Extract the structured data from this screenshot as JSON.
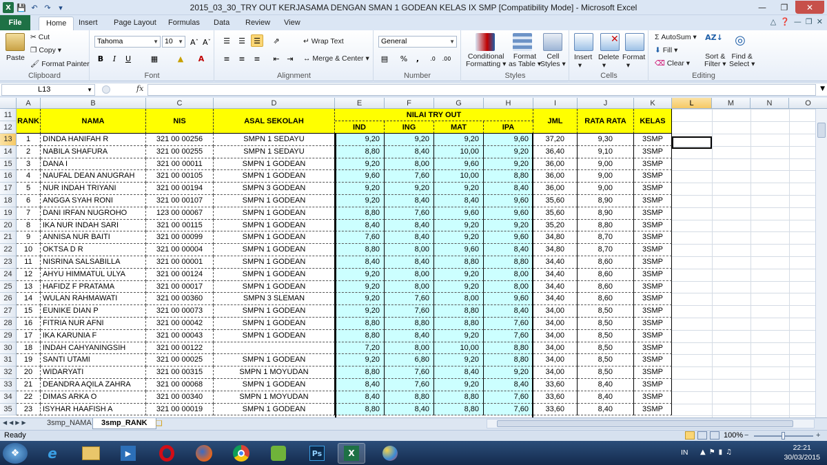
{
  "window": {
    "title": "2015_03_30_TRY OUT KERJASAMA DENGAN SMAN 1 GODEAN KELAS IX SMP  [Compatibility Mode]  -  Microsoft Excel"
  },
  "ribbon_tabs": [
    "File",
    "Home",
    "Insert",
    "Page Layout",
    "Formulas",
    "Data",
    "Review",
    "View"
  ],
  "ribbon": {
    "clipboard": {
      "paste": "Paste",
      "cut": "Cut",
      "copy": "Copy",
      "format_painter": "Format Painter",
      "group": "Clipboard"
    },
    "font": {
      "name": "Tahoma",
      "size": "10",
      "group": "Font"
    },
    "alignment": {
      "wrap_text": "Wrap Text",
      "merge_center": "Merge & Center",
      "group": "Alignment"
    },
    "number": {
      "format": "General",
      "group": "Number"
    },
    "styles": {
      "conditional": "Conditional",
      "conditional2": "Formatting",
      "format_table": "Format",
      "format_table2": "as Table",
      "cell_styles": "Cell",
      "cell_styles2": "Styles",
      "group": "Styles"
    },
    "cells": {
      "insert": "Insert",
      "delete": "Delete",
      "format": "Format",
      "group": "Cells"
    },
    "editing": {
      "autosum": "AutoSum",
      "fill": "Fill",
      "clear": "Clear",
      "sort": "Sort &",
      "sort2": "Filter",
      "find": "Find &",
      "find2": "Select",
      "group": "Editing"
    }
  },
  "formula_bar": {
    "name_box": "L13",
    "fx": "fx",
    "content": ""
  },
  "columns": [
    "A",
    "B",
    "C",
    "D",
    "E",
    "F",
    "G",
    "H",
    "I",
    "J",
    "K",
    "L",
    "M",
    "N",
    "O"
  ],
  "header": {
    "rank": "RANK",
    "nama": "NAMA",
    "nis": "NIS",
    "asal": "ASAL SEKOLAH",
    "nilai": "NILAI TRY OUT",
    "ind": "IND",
    "ing": "ING",
    "mat": "MAT",
    "ipa": "IPA",
    "jml": "JML",
    "rata": "RATA RATA",
    "kelas": "KELAS"
  },
  "row_numbers_header": [
    "11",
    "12"
  ],
  "rows": [
    {
      "r": "13",
      "rank": "1",
      "nama": "DINDA HANIFAH R",
      "nis": "321 00 00256",
      "asal": "SMPN 1 SEDAYU",
      "ind": "9,20",
      "ing": "9,20",
      "mat": "9,20",
      "ipa": "9,60",
      "jml": "37,20",
      "rata": "9,30",
      "kelas": "3SMP"
    },
    {
      "r": "14",
      "rank": "2",
      "nama": "NABILA SHAFURA",
      "nis": "321 00 00255",
      "asal": "SMPN 1 SEDAYU",
      "ind": "8,80",
      "ing": "8,40",
      "mat": "10,00",
      "ipa": "9,20",
      "jml": "36,40",
      "rata": "9,10",
      "kelas": "3SMP"
    },
    {
      "r": "15",
      "rank": "3",
      "nama": "DANA I",
      "nis": "321 00 00011",
      "asal": "SMPN 1 GODEAN",
      "ind": "9,20",
      "ing": "8,00",
      "mat": "9,60",
      "ipa": "9,20",
      "jml": "36,00",
      "rata": "9,00",
      "kelas": "3SMP"
    },
    {
      "r": "16",
      "rank": "4",
      "nama": "NAUFAL DEAN ANUGRAH",
      "nis": "321 00 00105",
      "asal": "SMPN 1 GODEAN",
      "ind": "9,60",
      "ing": "7,60",
      "mat": "10,00",
      "ipa": "8,80",
      "jml": "36,00",
      "rata": "9,00",
      "kelas": "3SMP"
    },
    {
      "r": "17",
      "rank": "5",
      "nama": "NUR INDAH TRIYANI",
      "nis": "321 00 00194",
      "asal": "SMPN 3 GODEAN",
      "ind": "9,20",
      "ing": "9,20",
      "mat": "9,20",
      "ipa": "8,40",
      "jml": "36,00",
      "rata": "9,00",
      "kelas": "3SMP"
    },
    {
      "r": "18",
      "rank": "6",
      "nama": "ANGGA SYAH RONI",
      "nis": "321 00 00107",
      "asal": "SMPN 1 GODEAN",
      "ind": "9,20",
      "ing": "8,40",
      "mat": "8,40",
      "ipa": "9,60",
      "jml": "35,60",
      "rata": "8,90",
      "kelas": "3SMP"
    },
    {
      "r": "19",
      "rank": "7",
      "nama": "DANI IRFAN NUGROHO",
      "nis": "123 00 00067",
      "asal": "SMPN 1 GODEAN",
      "ind": "8,80",
      "ing": "7,60",
      "mat": "9,60",
      "ipa": "9,60",
      "jml": "35,60",
      "rata": "8,90",
      "kelas": "3SMP"
    },
    {
      "r": "20",
      "rank": "8",
      "nama": "IKA NUR INDAH SARI",
      "nis": "321 00 00115",
      "asal": "SMPN 1 GODEAN",
      "ind": "8,40",
      "ing": "8,40",
      "mat": "9,20",
      "ipa": "9,20",
      "jml": "35,20",
      "rata": "8,80",
      "kelas": "3SMP"
    },
    {
      "r": "21",
      "rank": "9",
      "nama": "ANNISA NUR BAITI",
      "nis": "321 00 00099",
      "asal": "SMPN 1 GODEAN",
      "ind": "7,60",
      "ing": "8,40",
      "mat": "9,20",
      "ipa": "9,60",
      "jml": "34,80",
      "rata": "8,70",
      "kelas": "3SMP"
    },
    {
      "r": "22",
      "rank": "10",
      "nama": "OKTSA D R",
      "nis": "321 00 00004",
      "asal": "SMPN 1 GODEAN",
      "ind": "8,80",
      "ing": "8,00",
      "mat": "9,60",
      "ipa": "8,40",
      "jml": "34,80",
      "rata": "8,70",
      "kelas": "3SMP"
    },
    {
      "r": "23",
      "rank": "11",
      "nama": "NISRINA SALSABILLA",
      "nis": "321 00 00001",
      "asal": "SMPN 1 GODEAN",
      "ind": "8,40",
      "ing": "8,40",
      "mat": "8,80",
      "ipa": "8,80",
      "jml": "34,40",
      "rata": "8,60",
      "kelas": "3SMP"
    },
    {
      "r": "24",
      "rank": "12",
      "nama": "AHYU HIMMATUL ULYA",
      "nis": "321 00 00124",
      "asal": "SMPN 1 GODEAN",
      "ind": "9,20",
      "ing": "8,00",
      "mat": "9,20",
      "ipa": "8,00",
      "jml": "34,40",
      "rata": "8,60",
      "kelas": "3SMP"
    },
    {
      "r": "25",
      "rank": "13",
      "nama": "HAFIDZ F PRATAMA",
      "nis": "321 00 00017",
      "asal": "SMPN 1 GODEAN",
      "ind": "9,20",
      "ing": "8,00",
      "mat": "9,20",
      "ipa": "8,00",
      "jml": "34,40",
      "rata": "8,60",
      "kelas": "3SMP"
    },
    {
      "r": "26",
      "rank": "14",
      "nama": "WULAN RAHMAWATI",
      "nis": "321 00 00360",
      "asal": "SMPN 3 SLEMAN",
      "ind": "9,20",
      "ing": "7,60",
      "mat": "8,00",
      "ipa": "9,60",
      "jml": "34,40",
      "rata": "8,60",
      "kelas": "3SMP"
    },
    {
      "r": "27",
      "rank": "15",
      "nama": "EUNIKE DIAN P",
      "nis": "321 00 00073",
      "asal": "SMPN 1 GODEAN",
      "ind": "9,20",
      "ing": "7,60",
      "mat": "8,80",
      "ipa": "8,40",
      "jml": "34,00",
      "rata": "8,50",
      "kelas": "3SMP"
    },
    {
      "r": "28",
      "rank": "16",
      "nama": "FITRIA NUR AFNI",
      "nis": "321 00 00042",
      "asal": "SMPN 1 GODEAN",
      "ind": "8,80",
      "ing": "8,80",
      "mat": "8,80",
      "ipa": "7,60",
      "jml": "34,00",
      "rata": "8,50",
      "kelas": "3SMP"
    },
    {
      "r": "29",
      "rank": "17",
      "nama": "IKA KARUNIA F",
      "nis": "321 00 00043",
      "asal": "SMPN 1 GODEAN",
      "ind": "8,80",
      "ing": "8,40",
      "mat": "9,20",
      "ipa": "7,60",
      "jml": "34,00",
      "rata": "8,50",
      "kelas": "3SMP"
    },
    {
      "r": "30",
      "rank": "18",
      "nama": "INDAH CAHYANINGSIH",
      "nis": "321 00 00122",
      "asal": "",
      "ind": "7,20",
      "ing": "8,00",
      "mat": "10,00",
      "ipa": "8,80",
      "jml": "34,00",
      "rata": "8,50",
      "kelas": "3SMP"
    },
    {
      "r": "31",
      "rank": "19",
      "nama": "SANTI UTAMI",
      "nis": "321 00 00025",
      "asal": "SMPN 1 GODEAN",
      "ind": "9,20",
      "ing": "6,80",
      "mat": "9,20",
      "ipa": "8,80",
      "jml": "34,00",
      "rata": "8,50",
      "kelas": "3SMP"
    },
    {
      "r": "32",
      "rank": "20",
      "nama": "WIDARYATI",
      "nis": "321 00 00315",
      "asal": "SMPN 1 MOYUDAN",
      "ind": "8,80",
      "ing": "7,60",
      "mat": "8,40",
      "ipa": "9,20",
      "jml": "34,00",
      "rata": "8,50",
      "kelas": "3SMP"
    },
    {
      "r": "33",
      "rank": "21",
      "nama": "DEANDRA AQILA ZAHRA",
      "nis": "321 00 00068",
      "asal": "SMPN 1 GODEAN",
      "ind": "8,40",
      "ing": "7,60",
      "mat": "9,20",
      "ipa": "8,40",
      "jml": "33,60",
      "rata": "8,40",
      "kelas": "3SMP"
    },
    {
      "r": "34",
      "rank": "22",
      "nama": "DIMAS ARKA O",
      "nis": "321 00 00340",
      "asal": "SMPN 1 MOYUDAN",
      "ind": "8,40",
      "ing": "8,80",
      "mat": "8,80",
      "ipa": "7,60",
      "jml": "33,60",
      "rata": "8,40",
      "kelas": "3SMP"
    },
    {
      "r": "35",
      "rank": "23",
      "nama": "ISYHAR HAAFISH A",
      "nis": "321 00 00019",
      "asal": "SMPN 1 GODEAN",
      "ind": "8,80",
      "ing": "8,40",
      "mat": "8,80",
      "ipa": "7,60",
      "jml": "33,60",
      "rata": "8,40",
      "kelas": "3SMP"
    }
  ],
  "sheets": [
    "3smp_NAMA",
    "3smp_RANK"
  ],
  "status": {
    "ready": "Ready",
    "zoom": "100%"
  },
  "taskbar": {
    "lang": "IN",
    "time": "22:21",
    "date": "30/03/2015"
  },
  "colors": {
    "header_yellow": "#ffff00",
    "score_cyan": "#ccffff",
    "excel_green": "#1e7145"
  }
}
